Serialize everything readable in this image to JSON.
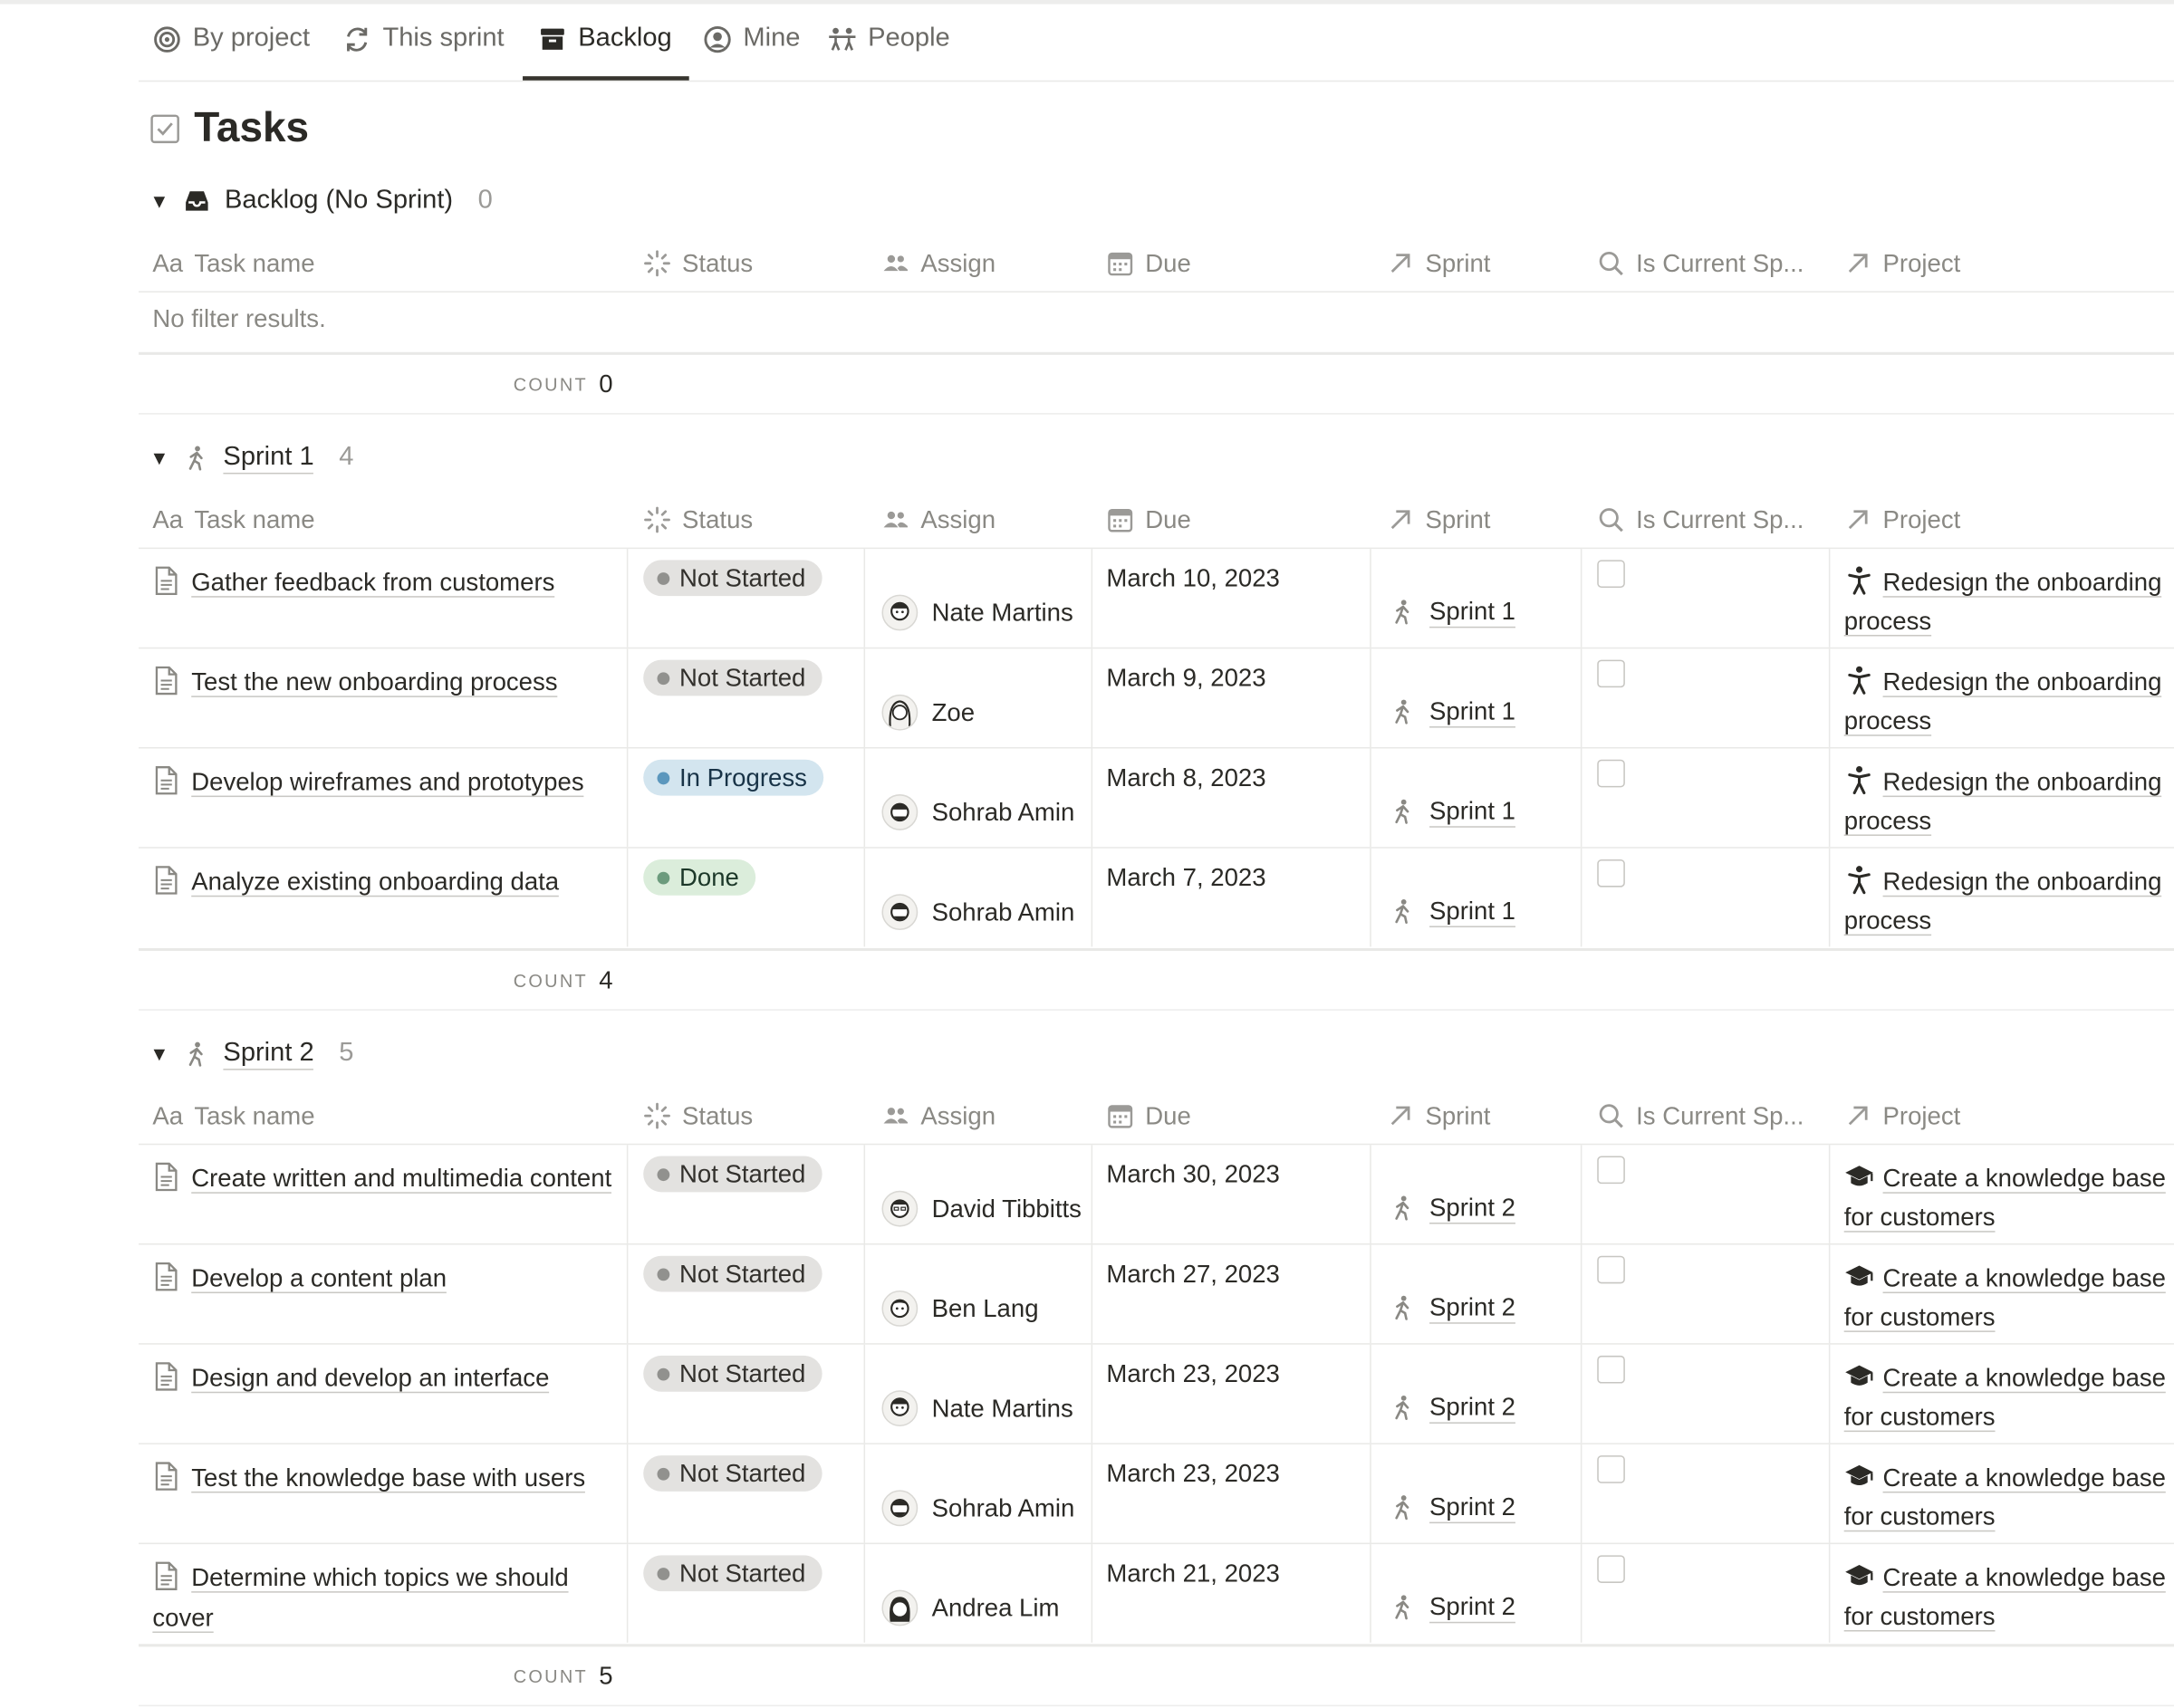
{
  "tabs": [
    {
      "label": "By project",
      "icon": "target-icon"
    },
    {
      "label": "This sprint",
      "icon": "refresh-icon"
    },
    {
      "label": "Backlog",
      "icon": "archive-icon"
    },
    {
      "label": "Mine",
      "icon": "user-circle-icon"
    },
    {
      "label": "People",
      "icon": "people-icon"
    }
  ],
  "page": {
    "title": "Tasks",
    "icon": "checkbox-icon"
  },
  "columns": {
    "task_name": "Task name",
    "task_name_prefix": "Aa",
    "status": "Status",
    "assign": "Assign",
    "due": "Due",
    "sprint": "Sprint",
    "is_current": "Is Current Sp...",
    "project": "Project"
  },
  "count_label": "COUNT",
  "groups": [
    {
      "name": "Backlog (No Sprint)",
      "icon": "inbox-icon",
      "count": "0",
      "empty_text": "No filter results.",
      "footer_count": "0",
      "rows": []
    },
    {
      "name": "Sprint 1",
      "icon": "walking-person-icon",
      "count": "4",
      "footer_count": "4",
      "rows": [
        {
          "task": "Gather feedback from customers",
          "status": "Not Started",
          "assignee": "Nate Martins",
          "due": "March 10, 2023",
          "sprint": "Sprint 1",
          "project": "Redesign the onboarding process"
        },
        {
          "task": "Test the new onboarding process",
          "status": "Not Started",
          "assignee": "Zoe",
          "due": "March 9, 2023",
          "sprint": "Sprint 1",
          "project": "Redesign the onboarding process"
        },
        {
          "task": "Develop wireframes and prototypes",
          "status": "In Progress",
          "assignee": "Sohrab Amin",
          "due": "March 8, 2023",
          "sprint": "Sprint 1",
          "project": "Redesign the onboarding process"
        },
        {
          "task": "Analyze existing onboarding data",
          "status": "Done",
          "assignee": "Sohrab Amin",
          "due": "March 7, 2023",
          "sprint": "Sprint 1",
          "project": "Redesign the onboarding process"
        }
      ]
    },
    {
      "name": "Sprint 2",
      "icon": "walking-person-icon",
      "count": "5",
      "footer_count": "5",
      "rows": [
        {
          "task": "Create written and multimedia content",
          "status": "Not Started",
          "assignee": "David Tibbitts",
          "due": "March 30, 2023",
          "sprint": "Sprint 2",
          "project": "Create a knowledge base for customers"
        },
        {
          "task": "Develop a content plan",
          "status": "Not Started",
          "assignee": "Ben Lang",
          "due": "March 27, 2023",
          "sprint": "Sprint 2",
          "project": "Create a knowledge base for customers"
        },
        {
          "task": "Design and develop an interface",
          "status": "Not Started",
          "assignee": "Nate Martins",
          "due": "March 23, 2023",
          "sprint": "Sprint 2",
          "project": "Create a knowledge base for customers"
        },
        {
          "task": "Test the knowledge base with users",
          "status": "Not Started",
          "assignee": "Sohrab Amin",
          "due": "March 23, 2023",
          "sprint": "Sprint 2",
          "project": "Create a knowledge base for customers"
        },
        {
          "task": "Determine which topics we should cover",
          "status": "Not Started",
          "assignee": "Andrea Lim",
          "due": "March 21, 2023",
          "sprint": "Sprint 2",
          "project": "Create a knowledge base for customers"
        }
      ]
    }
  ],
  "colors": {
    "not_started": "#e3e2e0",
    "in_progress": "#d3e5ef",
    "done": "#dbeddb",
    "text": "#37352f",
    "muted": "#8a8984"
  }
}
